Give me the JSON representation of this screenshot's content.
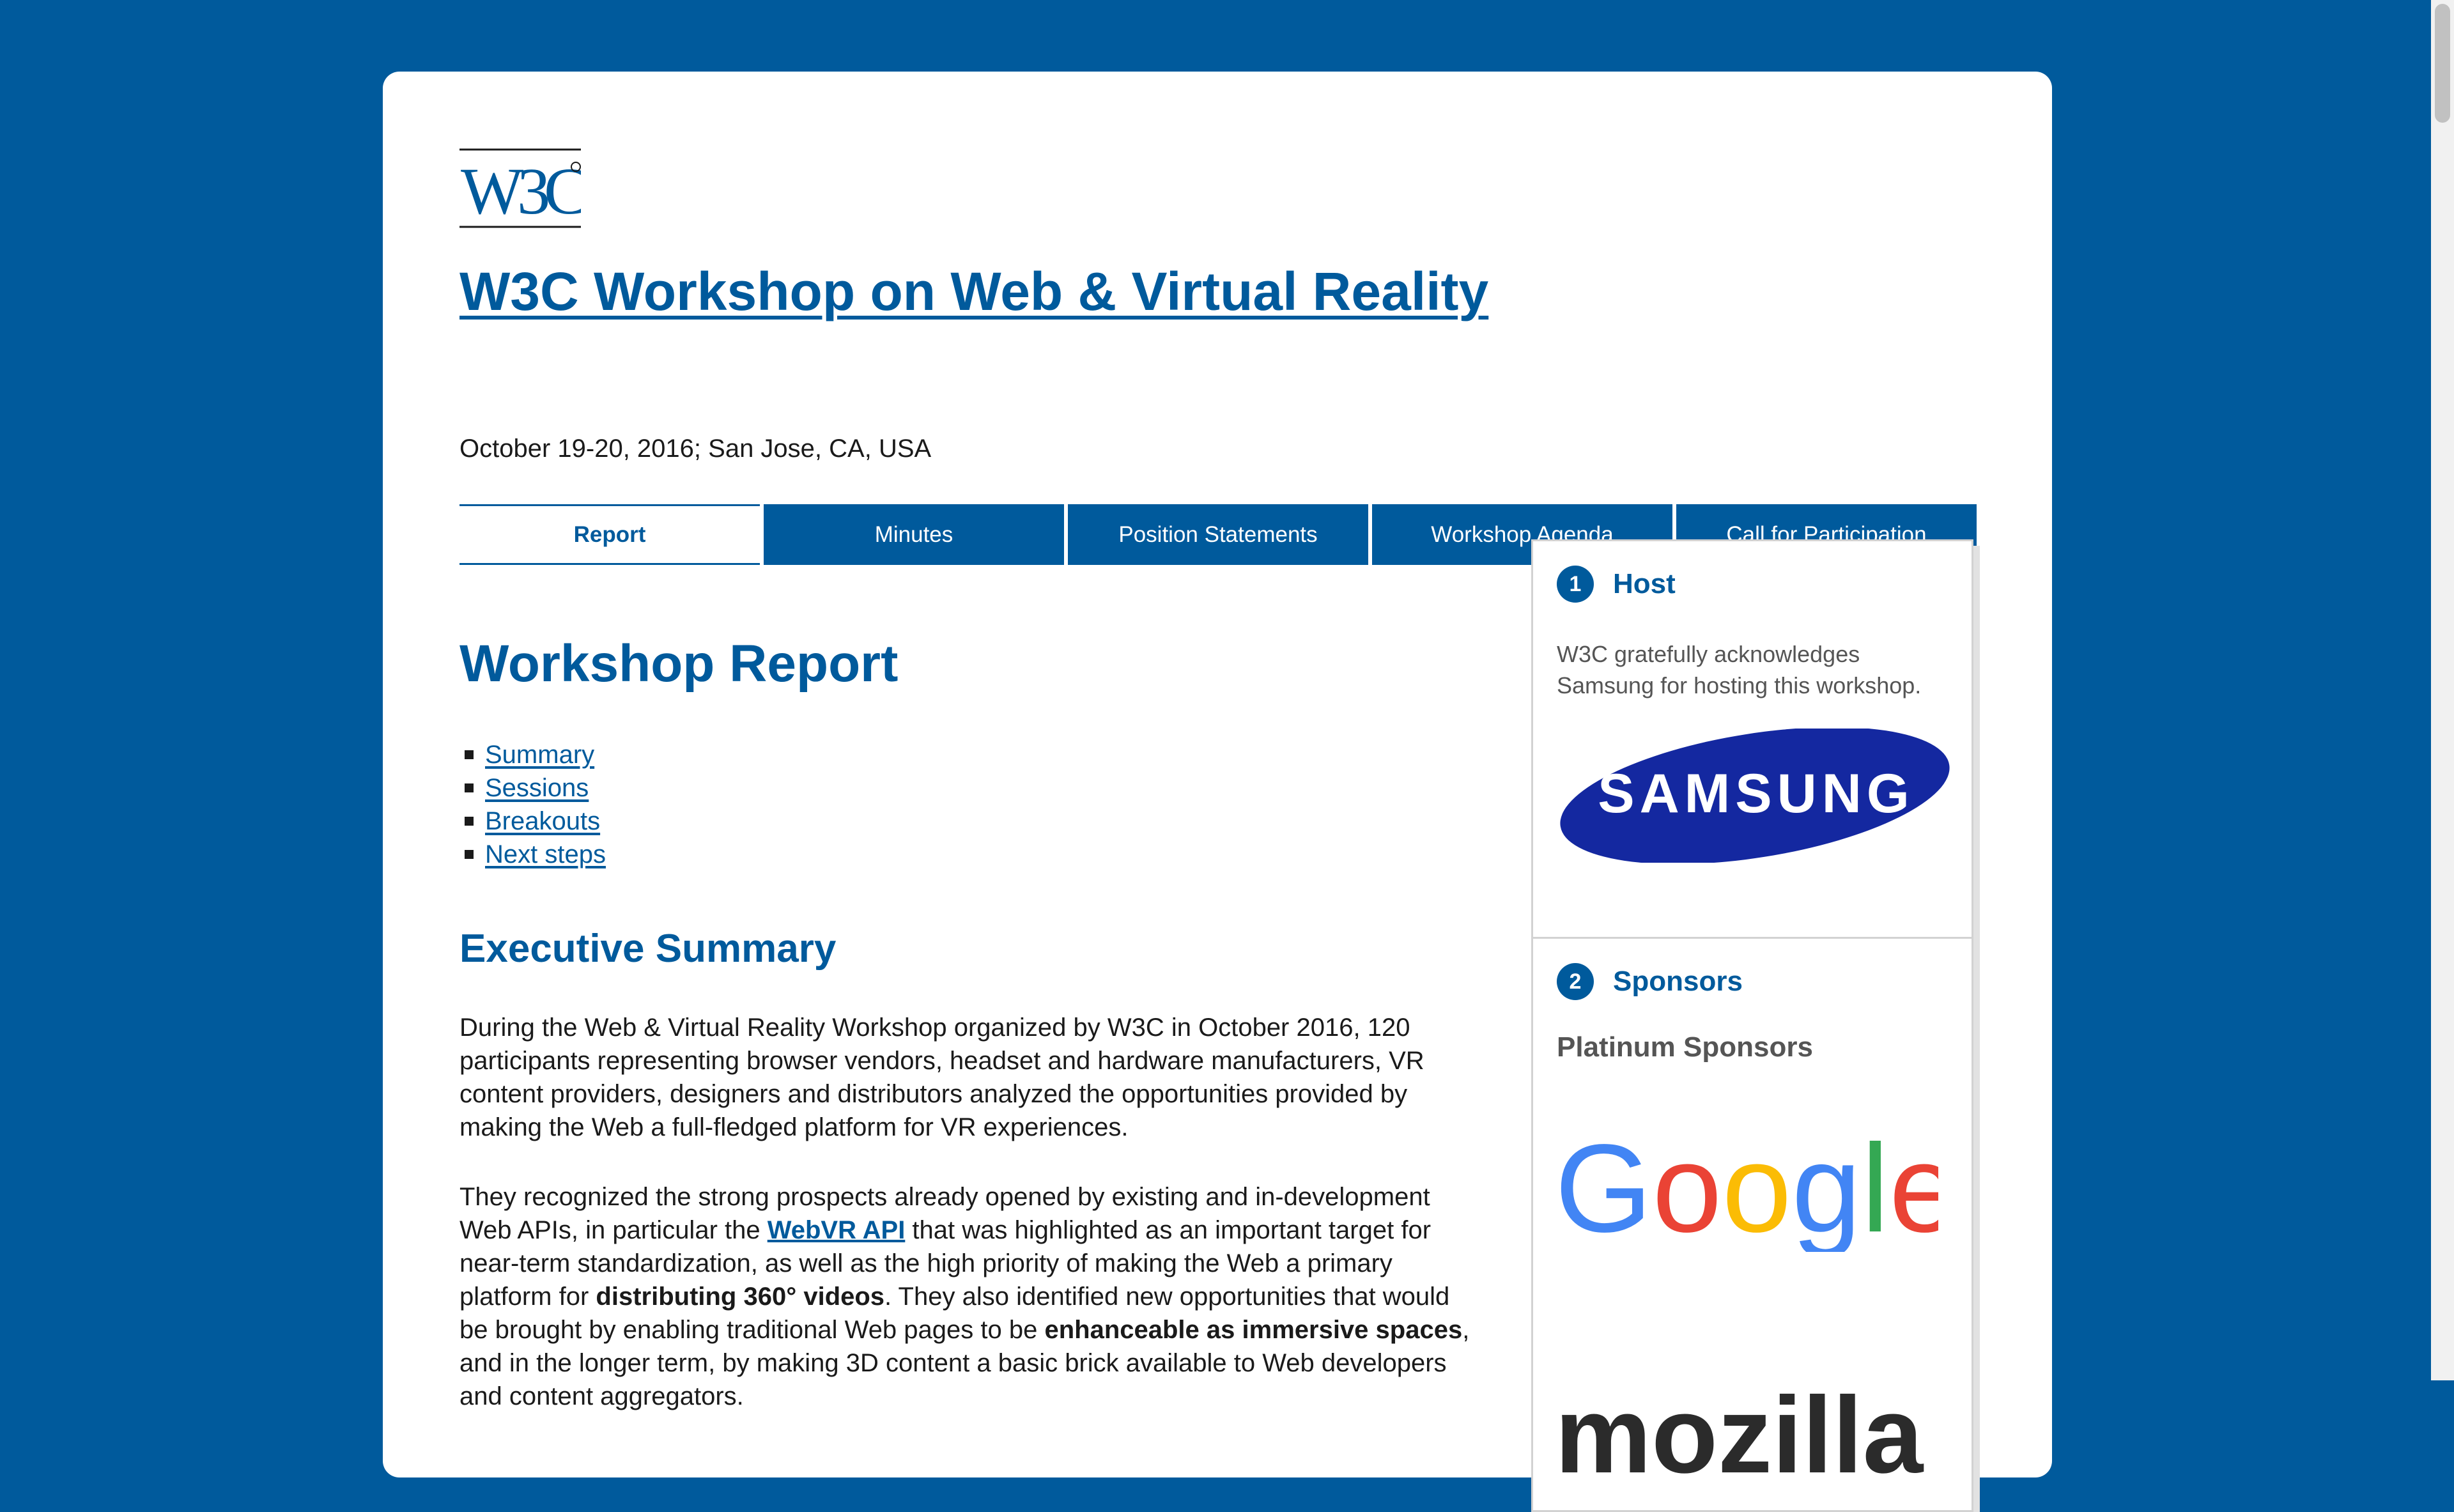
{
  "header": {
    "logo_text": "W3C",
    "title": "W3C Workshop on Web & Virtual Reality",
    "date_location": "October 19-20, 2016; San Jose, CA, USA"
  },
  "tabs": [
    {
      "label": "Report",
      "active": true
    },
    {
      "label": "Minutes",
      "active": false
    },
    {
      "label": "Position Statements",
      "active": false
    },
    {
      "label": "Workshop Agenda",
      "active": false
    },
    {
      "label": "Call for Participation",
      "active": false
    }
  ],
  "main": {
    "heading": "Workshop Report",
    "toc": [
      "Summary",
      "Sessions",
      "Breakouts",
      "Next steps"
    ],
    "exec_heading": "Executive Summary",
    "para1": "During the Web & Virtual Reality Workshop organized by W3C in October 2016, 120 participants representing browser vendors, headset and hardware manufacturers, VR content providers, designers and distributors analyzed the opportunities provided by making the Web a full-fledged platform for VR experiences.",
    "para2": {
      "t1": "They recognized the strong prospects already opened by existing and in-development Web APIs, in particular the ",
      "link": "WebVR API",
      "t2": " that was highlighted as an important target for near-term standardization, as well as the high priority of making the Web a primary platform for ",
      "b1": "distributing 360° videos",
      "t3": ". They also identified new opportunities that would be brought by enabling traditional Web pages to be ",
      "b2": "enhanceable as immersive spaces",
      "t4": ", and in the longer term, by making 3D content a basic brick available to Web developers and content aggregators."
    }
  },
  "sidebar": {
    "host": {
      "number": "1",
      "title": "Host",
      "text": "W3C gratefully acknowledges Samsung for hosting this workshop.",
      "logo_text": "SAMSUNG"
    },
    "sponsors": {
      "number": "2",
      "title": "Sponsors",
      "platinum_label": "Platinum Sponsors",
      "logos": [
        "Google",
        "mozilla"
      ]
    }
  },
  "colors": {
    "w3c_blue": "#005a9c",
    "samsung_blue": "#1428a0",
    "google_blue": "#4285f4",
    "google_red": "#ea4335",
    "google_yellow": "#fbbc05",
    "google_green": "#34a853"
  }
}
